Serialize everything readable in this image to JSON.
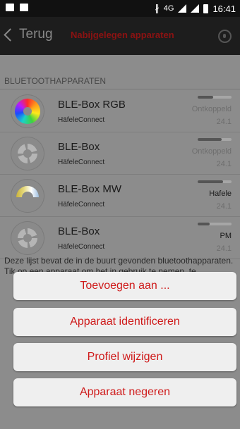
{
  "statusbar": {
    "icons": [
      "image-icon",
      "cast-icon",
      "bluetooth-icon",
      "signal-icon",
      "signal-icon",
      "battery-icon"
    ],
    "network": "4G",
    "time": "16:41"
  },
  "toolbar": {
    "back_label": "Terug",
    "title": "Nabijgelegen apparaten",
    "bluetooth_icon": "bluetooth-scan-icon"
  },
  "section": {
    "header": "BLUETOOTHAPPARATEN"
  },
  "devices": [
    {
      "name": "BLE-Box RGB",
      "vendor": "HäfeleConnect",
      "status": "Ontkoppeld",
      "version": "24.1",
      "icon": "rgb-color-wheel-icon",
      "signal": 0.45
    },
    {
      "name": "BLE-Box",
      "vendor": "HäfeleConnect",
      "status": "Ontkoppeld",
      "version": "24.1",
      "icon": "ble-box-icon",
      "signal": 0.7
    },
    {
      "name": "BLE-Box MW",
      "vendor": "HäfeleConnect",
      "status": "Hafele",
      "version": "24.1",
      "icon": "multi-white-icon",
      "signal": 0.75
    },
    {
      "name": "BLE-Box",
      "vendor": "HäfeleConnect",
      "status": "PM",
      "version": "24.1",
      "icon": "ble-box-icon",
      "signal": 0.35
    }
  ],
  "info_text": "Deze lijst bevat de in de buurt gevonden bluetoothapparaten. Tik op een apparaat om het in gebruik te nemen, te ontkoppelen of de firmware bij te",
  "actions": {
    "add": "Toevoegen aan ...",
    "identify": "Apparaat identificeren",
    "profile": "Profiel wijzigen",
    "ignore": "Apparaat negeren"
  },
  "colors": {
    "accent": "#cf1a1a",
    "title": "#8c1212",
    "scrim": "#8c8c8c"
  }
}
